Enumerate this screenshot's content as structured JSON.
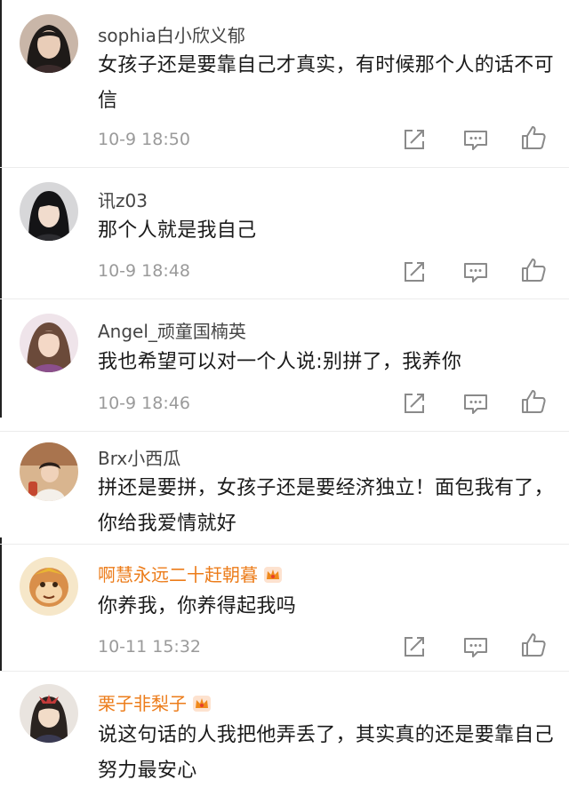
{
  "comments": [
    {
      "username": "sophia白小欣义郁",
      "vip": false,
      "text": "女孩子还是要靠自己才真实，有时候那个人的话不可信",
      "time": "10-9 18:50",
      "avatar": "woman-dark-hair-avatar"
    },
    {
      "username": "讯z03",
      "vip": false,
      "text": "那个人就是我自己",
      "time": "10-9 18:48",
      "avatar": "girl-bangs-avatar"
    },
    {
      "username": "Angel_顽童国楠英",
      "vip": false,
      "text": "我也希望可以对一个人说:别拼了，我养你",
      "time": "10-9 18:46",
      "avatar": "woman-light-hair-avatar"
    },
    {
      "username": "Brx小西瓜",
      "vip": false,
      "text": "拼还是要拼，女孩子还是要经济独立！面包我有了，你给我爱情就好",
      "time": "",
      "avatar": "child-photo-avatar"
    },
    {
      "username": "啊慧永远二十赶朝暮",
      "vip": true,
      "text": "你养我，你养得起我吗",
      "time": "10-11 15:32",
      "avatar": "cartoon-monkey-avatar"
    },
    {
      "username": "栗子非梨子",
      "vip": true,
      "text": "说这句话的人我把他弄丢了，其实真的还是要靠自己努力最安心",
      "time": "",
      "avatar": "anime-girl-avatar"
    }
  ],
  "icons": {
    "share": "share-icon",
    "reply": "reply-icon",
    "like": "like-icon",
    "vip": "crown-icon"
  },
  "colors": {
    "username": "#444444",
    "vip_username": "#ec7c1a",
    "text": "#1a1a1a",
    "meta": "#9a9a9a",
    "divider": "#ececec"
  }
}
